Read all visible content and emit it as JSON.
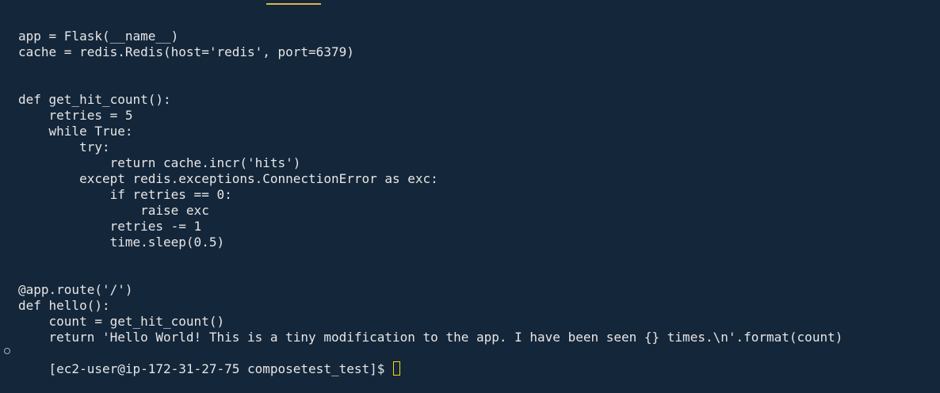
{
  "code_lines": [
    "app = Flask(__name__)",
    "cache = redis.Redis(host='redis', port=6379)",
    "",
    "",
    "def get_hit_count():",
    "    retries = 5",
    "    while True:",
    "        try:",
    "            return cache.incr('hits')",
    "        except redis.exceptions.ConnectionError as exc:",
    "            if retries == 0:",
    "                raise exc",
    "            retries -= 1",
    "            time.sleep(0.5)",
    "",
    "",
    "@app.route('/')",
    "def hello():",
    "    count = get_hit_count()",
    "    return 'Hello World! This is a tiny modification to the app. I have been seen {} times.\\n'.format(count)"
  ],
  "prompt": "[ec2-user@ip-172-31-27-75 composetest_test]$ ",
  "colors": {
    "background": "#14263a",
    "text": "#e6e6e6",
    "cursor": "#ffd400",
    "top_accent": "#d7b84a"
  },
  "icons": {
    "prompt_marker": "circle-outline-icon",
    "cursor": "block-cursor-icon"
  }
}
